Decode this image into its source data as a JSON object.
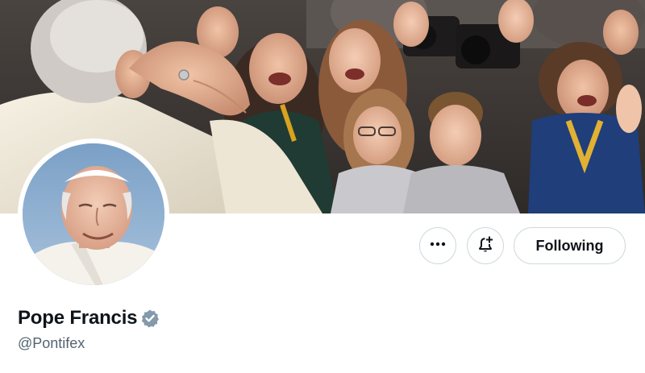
{
  "profile": {
    "display_name": "Pope Francis",
    "handle": "@Pontifex",
    "verified_badge": "gray-check-badge-icon",
    "badge_color": "#829aab"
  },
  "actions": {
    "more_icon": "ellipsis-icon",
    "notify_icon": "bell-plus-icon",
    "follow_label": "Following"
  },
  "banner": {
    "description_icon": "crowd-photo"
  },
  "colors": {
    "text_primary": "#0f1419",
    "text_secondary": "#536471",
    "button_border": "#cfd9de"
  }
}
